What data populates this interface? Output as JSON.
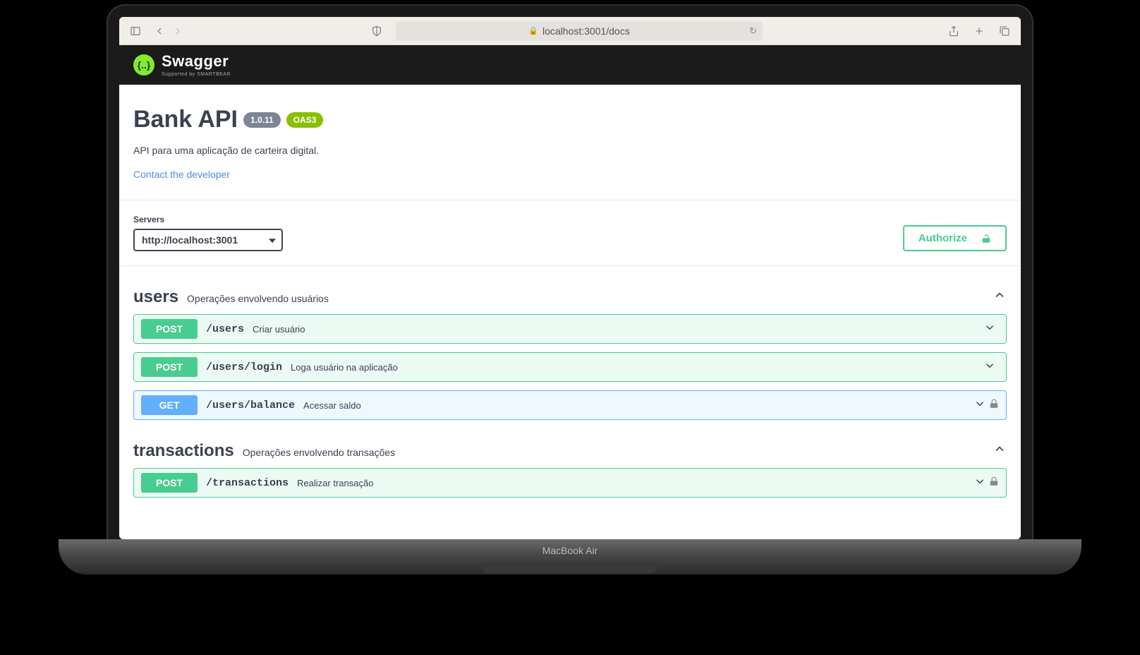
{
  "device_label": "MacBook Air",
  "browser": {
    "url": "localhost:3001/docs"
  },
  "swagger_brand": {
    "name": "Swagger",
    "subline": "Supported by SMARTBEAR"
  },
  "api": {
    "title": "Bank API",
    "version": "1.0.11",
    "oas_version": "OAS3",
    "description": "API para uma aplicação de carteira digital.",
    "contact_label": "Contact the developer"
  },
  "servers": {
    "label": "Servers",
    "selected": "http://localhost:3001"
  },
  "authorize_label": "Authorize",
  "tags": {
    "users": {
      "name": "users",
      "description": "Operações envolvendo usuários",
      "ops": [
        {
          "method": "POST",
          "path": "/users",
          "summary": "Criar usuário",
          "locked": false
        },
        {
          "method": "POST",
          "path": "/users/login",
          "summary": "Loga usuário na aplicação",
          "locked": false
        },
        {
          "method": "GET",
          "path": "/users/balance",
          "summary": "Acessar saldo",
          "locked": true
        }
      ]
    },
    "transactions": {
      "name": "transactions",
      "description": "Operações envolvendo transações",
      "ops": [
        {
          "method": "POST",
          "path": "/transactions",
          "summary": "Realizar transação",
          "locked": true
        }
      ]
    }
  }
}
